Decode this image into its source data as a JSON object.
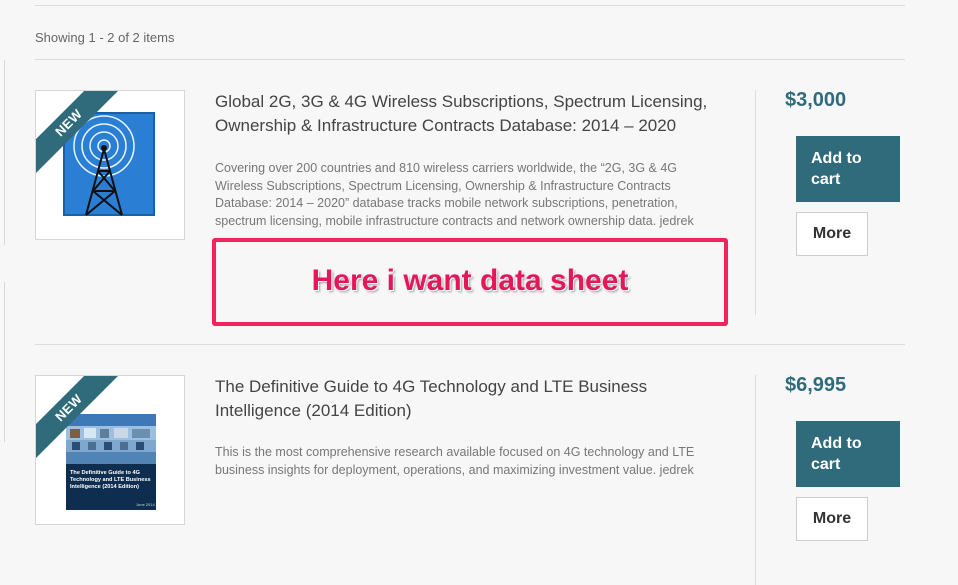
{
  "listing": {
    "showing_text": "Showing 1 - 2 of 2 items"
  },
  "products": [
    {
      "badge": "NEW",
      "title": "Global 2G, 3G & 4G Wireless Subscriptions, Spectrum Licensing, Ownership & Infrastructure Contracts Database: 2014 – 2020",
      "description": "Covering over 200 countries and 810 wireless carriers worldwide, the “2G, 3G & 4G Wireless Subscriptions, Spectrum Licensing, Ownership & Infrastructure Contracts Database: 2014 – 2020” database tracks mobile network subscriptions, penetration, spectrum licensing, mobile infrastructure contracts and network ownership data. jedrek",
      "price": "$3,000",
      "add_to_cart": "Add to cart",
      "more": "More",
      "cover_icon": "radio-tower-icon"
    },
    {
      "badge": "NEW",
      "title": "The Definitive Guide to 4G Technology and LTE Business Intelligence (2014 Edition)",
      "description": "This is the most comprehensive research available focused on 4G technology and LTE business insights for deployment, operations, and maximizing investment value. jedrek",
      "price": "$6,995",
      "add_to_cart": "Add to cart",
      "more": "More",
      "cover_title": "The Definitive Guide to 4G Technology and LTE Business Intelligence (2014 Edition)",
      "cover_date": "June 2014"
    }
  ],
  "annotation": {
    "text": "Here i want data sheet",
    "color": "#f1245b"
  },
  "colors": {
    "accent": "#2f6b7b",
    "background": "#f7f7f7"
  }
}
